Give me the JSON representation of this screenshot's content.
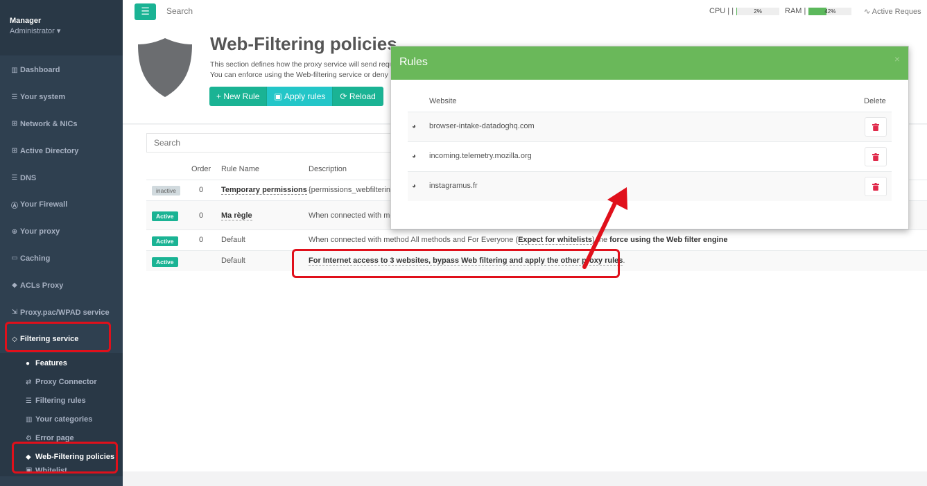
{
  "sidebar": {
    "user": "Manager",
    "role": "Administrator",
    "items": [
      {
        "label": "Dashboard",
        "icon": "dashboard-icon"
      },
      {
        "label": "Your system",
        "icon": "server-icon"
      },
      {
        "label": "Network & NICs",
        "icon": "sitemap-icon"
      },
      {
        "label": "Active Directory",
        "icon": "windows-icon"
      },
      {
        "label": "DNS",
        "icon": "database-icon"
      },
      {
        "label": "Your Firewall",
        "icon": "firewall-icon"
      },
      {
        "label": "Your proxy",
        "icon": "globe-icon"
      },
      {
        "label": "Caching",
        "icon": "monitor-icon"
      },
      {
        "label": "ACLs Proxy",
        "icon": "shield-icon"
      },
      {
        "label": "Proxy.pac/WPAD service",
        "icon": "network-icon"
      },
      {
        "label": "Filtering service",
        "icon": "shield-check-icon"
      }
    ],
    "sub_items": [
      {
        "label": "Features",
        "icon": "palette-icon"
      },
      {
        "label": "Proxy Connector",
        "icon": "exchange-icon"
      },
      {
        "label": "Filtering rules",
        "icon": "list-icon"
      },
      {
        "label": "Your categories",
        "icon": "book-icon"
      },
      {
        "label": "Error page",
        "icon": "error-page-icon"
      },
      {
        "label": "Web-Filtering policies",
        "icon": "shield-icon"
      },
      {
        "label": "Whitelist",
        "icon": "whitelist-icon"
      }
    ]
  },
  "topbar": {
    "search_placeholder": "Search",
    "cpu_label": "CPU",
    "cpu_value": "2%",
    "cpu_fraction": 0.02,
    "ram_label": "RAM",
    "ram_value": "42%",
    "ram_fraction": 0.42,
    "active_requests": "Active Reques"
  },
  "header": {
    "title": "Web-Filtering policies",
    "desc_line1": "This section defines how the proxy service will send requ",
    "desc_line2": "You can enforce using the Web-filtering service or deny",
    "buttons": {
      "new_rule": "+ New Rule",
      "apply": "Apply rules",
      "reload": "Reload"
    }
  },
  "table": {
    "search_placeholder": "Search",
    "headers": {
      "order": "Order",
      "name": "Rule Name",
      "description": "Description"
    },
    "rows": [
      {
        "status": "inactive",
        "order": "0",
        "name": "Temporary permissions",
        "description": "{permissions_webfiltering"
      },
      {
        "status": "Active",
        "order": "0",
        "name": "Ma règle",
        "description": "When connected with me"
      },
      {
        "status": "Active",
        "order": "0",
        "name": "Default",
        "description_prefix": "When connected with method All methods and For Everyone (",
        "description_link": "Expect for whitelists",
        "description_suffix": ") the ",
        "description_bold": "force using the Web filter engine"
      },
      {
        "status": "Active",
        "order": "",
        "name": "Default",
        "description_link": "For Internet access to 3 websites, bypass Web filtering and apply the other proxy rules",
        "description_suffix": "."
      }
    ]
  },
  "modal": {
    "title": "Rules",
    "close": "×",
    "col_website": "Website",
    "col_delete": "Delete",
    "sites": [
      "browser-intake-datadoghq.com",
      "incoming.telemetry.mozilla.org",
      "instagramus.fr"
    ]
  },
  "colors": {
    "accent": "#1ab394",
    "sidebar": "#2f4050",
    "modal_header": "#6ab85a",
    "annotation": "#e0101b",
    "delete": "#e0294a"
  }
}
